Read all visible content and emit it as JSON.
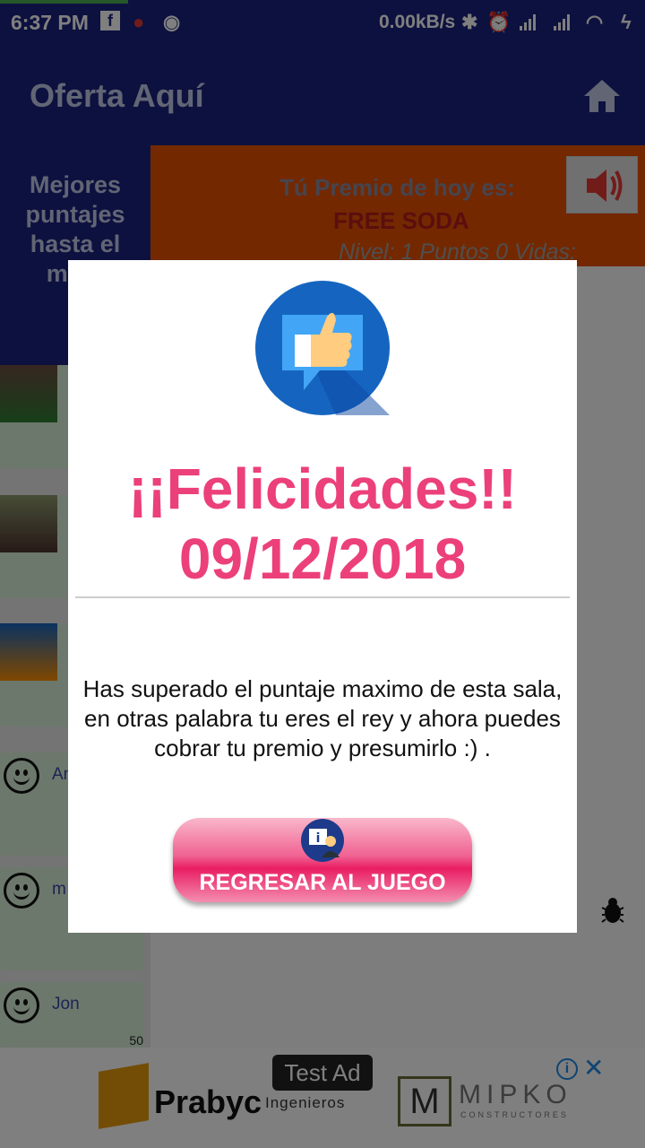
{
  "status_bar": {
    "time": "6:37 PM",
    "net_speed": "0.00kB/s"
  },
  "app_bar": {
    "title": "Oferta Aquí",
    "home_icon": "home-icon"
  },
  "leaderboard": {
    "header": "Mejores puntajes hasta el mom",
    "entries": [
      {
        "name": "An",
        "points": ""
      },
      {
        "name": "m",
        "points": ""
      },
      {
        "name": "Jon",
        "points": "50"
      }
    ]
  },
  "prize": {
    "label": "Tú Premio de hoy es:",
    "value": "FREE SODA",
    "stats": "Nivel: 1  Puntos 0  Vidas:"
  },
  "dialog": {
    "heading_line1": "¡¡Felicidades!!",
    "heading_line2": "09/12/2018",
    "message": "Has superado el puntaje maximo de esta sala, en otras palabra tu eres el rey y ahora puedes cobrar tu premio y presumirlo :) .",
    "button_label": "REGRESAR AL JUEGO"
  },
  "ad": {
    "tag": "Test Ad",
    "brand1": "Prabyc",
    "brand1_sub": "Ingenieros",
    "brand2": "MIPKO",
    "brand2_sub": "CONSTRUCTORES"
  },
  "colors": {
    "primary": "#1a237e",
    "accent_pink": "#ec407a",
    "orange": "#e65100"
  }
}
